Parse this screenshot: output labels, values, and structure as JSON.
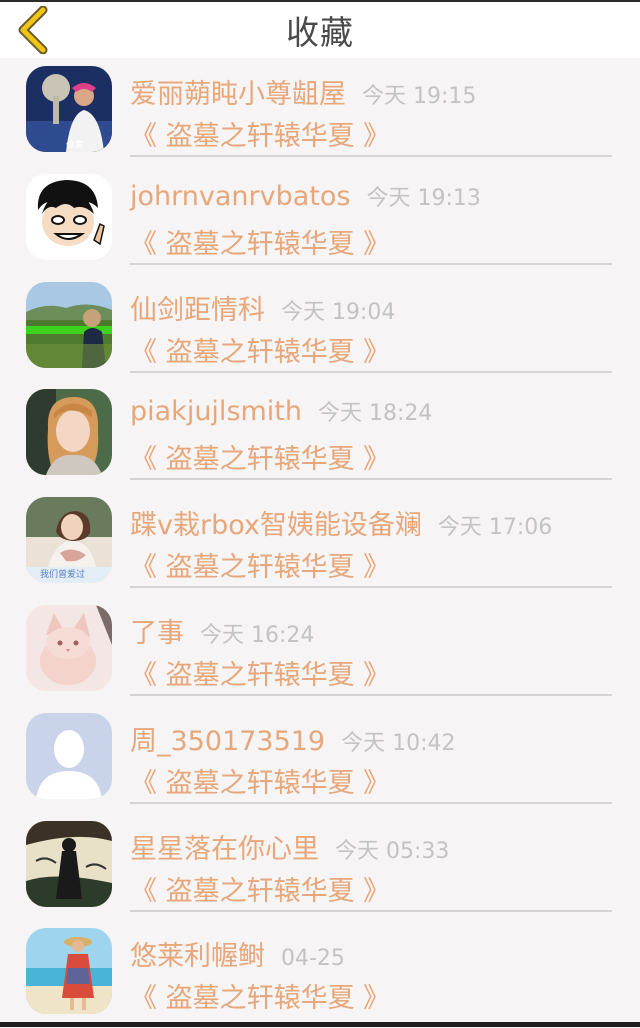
{
  "header": {
    "title": "收藏"
  },
  "colors": {
    "accent": "#e7a77a",
    "back_arrow": "#f0c419",
    "time": "#c3c3c3",
    "separator": "#d6d3d3",
    "background": "#f6f4f4"
  },
  "items": [
    {
      "name": "爱丽蒴盹小尊龃屋",
      "time": "今天 19:15",
      "book": "《 盗墓之轩辕华夏 》",
      "avatar": "avatar-tennis-player"
    },
    {
      "name": "johrnvanrvbatos",
      "time": "今天 19:13",
      "book": "《 盗墓之轩辕华夏 》",
      "avatar": "avatar-cartoon-boy"
    },
    {
      "name": "仙剑距情科",
      "time": "今天 19:04",
      "book": "《 盗墓之轩辕华夏 》",
      "avatar": "avatar-field-landscape"
    },
    {
      "name": "piakjujlsmith",
      "time": "今天 18:24",
      "book": "《 盗墓之轩辕华夏 》",
      "avatar": "avatar-girl-portrait"
    },
    {
      "name": "蹀v栽rbox智姨能设备斓",
      "time": "今天 17:06",
      "book": "《 盗墓之轩辕华夏 》",
      "avatar": "avatar-girl-scarf"
    },
    {
      "name": "了事",
      "time": "今天 16:24",
      "book": "《 盗墓之轩辕华夏 》",
      "avatar": "avatar-pink-cat"
    },
    {
      "name": "周_350173519",
      "time": "今天 10:42",
      "book": "《 盗墓之轩辕华夏 》",
      "avatar": "avatar-default-silhouette"
    },
    {
      "name": "星星落在你心里",
      "time": "今天 05:33",
      "book": "《 盗墓之轩辕华夏 》",
      "avatar": "avatar-illustrated-girl"
    },
    {
      "name": "悠莱利幄鲥",
      "time": "04-25",
      "book": "《 盗墓之轩辕华夏 》",
      "avatar": "avatar-beach-girl"
    }
  ]
}
